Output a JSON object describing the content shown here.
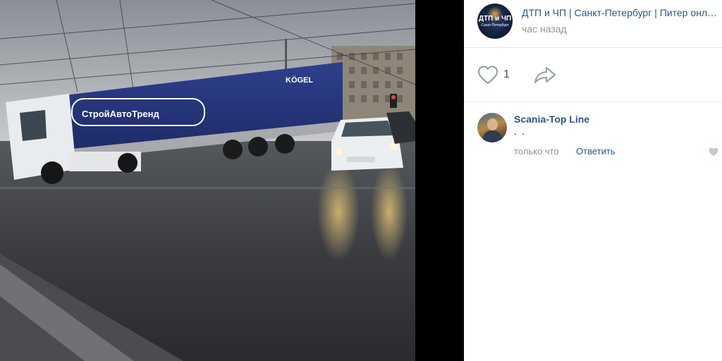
{
  "photo": {
    "trailer_brand": "KÖGEL",
    "trailer_company": "СтройАвтоТренд",
    "icon": "photo-accident-scene"
  },
  "post": {
    "group_name": "ДТП и ЧП | Санкт-Петербург | Питер онлайн | СПб",
    "time": "час назад",
    "avatar_text": "ДТП и ЧП",
    "avatar_subtext": "Санкт-Петербург"
  },
  "actions": {
    "like_icon": "heart-icon",
    "like_count": "1",
    "share_icon": "share-arrow-icon"
  },
  "comments": [
    {
      "author": "Scania-Top Line",
      "text": ". .",
      "time": "только что",
      "reply_label": "Ответить",
      "like_icon": "heart-icon"
    }
  ],
  "colors": {
    "link": "#2a5885",
    "muted": "#939393",
    "divider": "#e7e8ec",
    "icon": "#99a2ad"
  }
}
